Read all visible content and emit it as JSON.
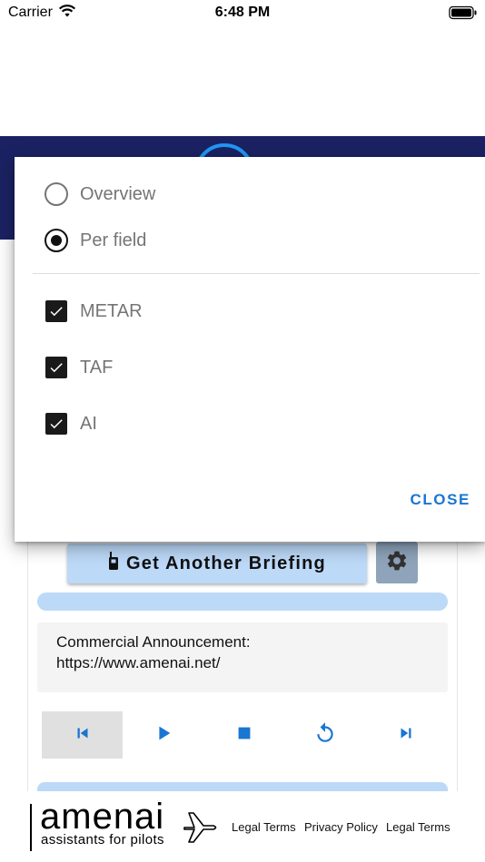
{
  "status_bar": {
    "carrier": "Carrier",
    "time": "6:48 PM"
  },
  "main": {
    "briefing_button_label": "Get Another Briefing",
    "announcement_line1": "Commercial Announcement:",
    "announcement_line2": "https://www.amenai.net/",
    "controls": [
      "skip-previous-icon",
      "play-icon",
      "stop-icon",
      "replay-icon",
      "skip-next-icon"
    ]
  },
  "footer": {
    "logo_word": "amenai",
    "logo_tagline": "assistants for pilots",
    "links": [
      "Legal Terms",
      "Privacy Policy",
      "Legal Terms"
    ]
  },
  "modal": {
    "view_options": [
      {
        "label": "Overview",
        "selected": false
      },
      {
        "label": "Per field",
        "selected": true
      }
    ],
    "filters": [
      {
        "label": "METAR",
        "checked": true
      },
      {
        "label": "TAF",
        "checked": true
      },
      {
        "label": "AI",
        "checked": true
      }
    ],
    "close_label": "CLOSE"
  },
  "colors": {
    "header": "#1b2263",
    "accent": "#1976d2",
    "button_bg": "#bcd9f8",
    "settings_bg": "#8fa4bb"
  }
}
